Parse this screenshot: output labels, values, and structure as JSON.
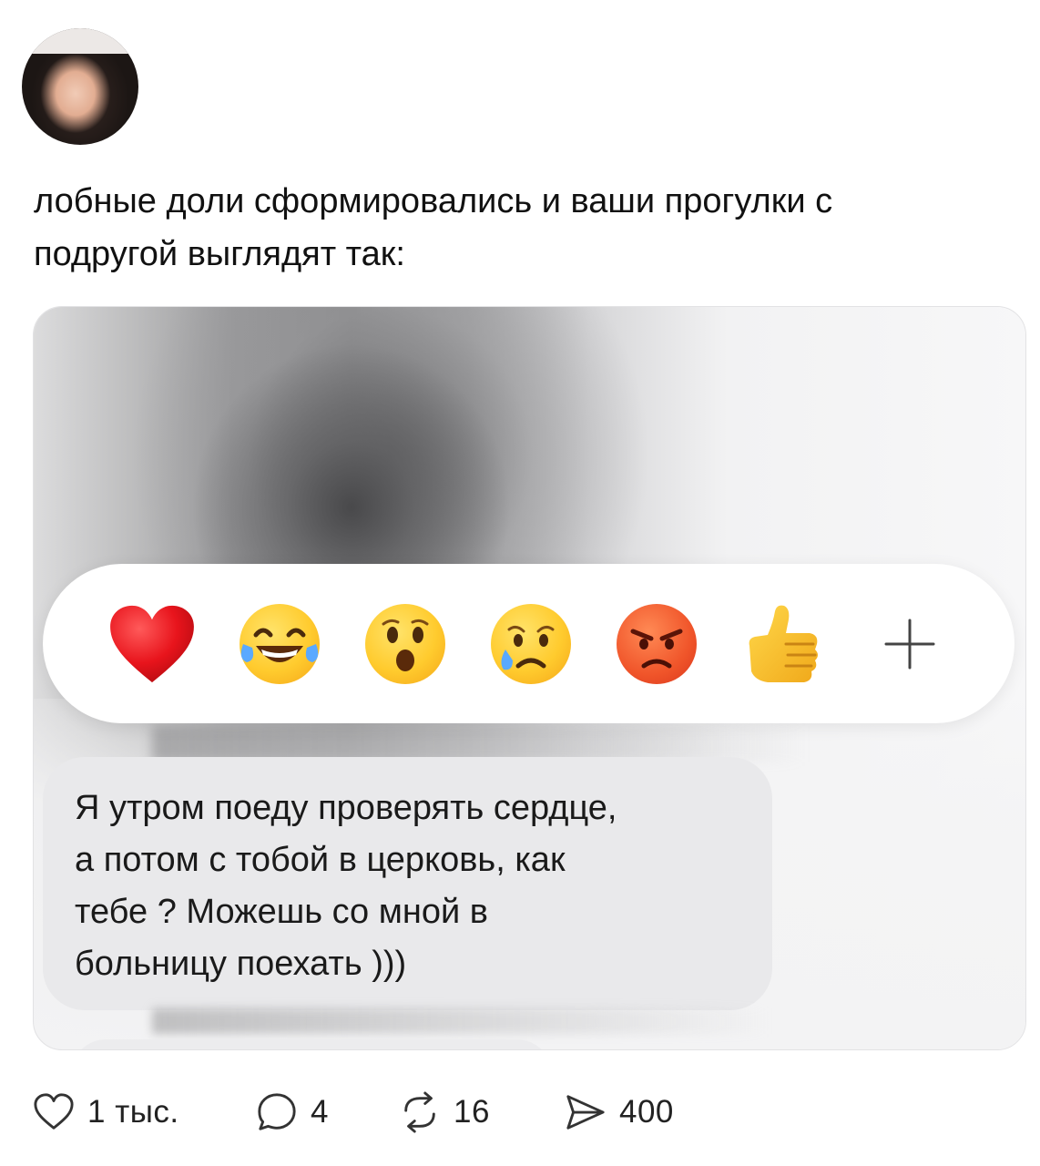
{
  "post": {
    "text_line1": "лобные доли сформировались и ваши прогулки с",
    "text_line2": "подругой выглядят так:"
  },
  "reactions": {
    "items": [
      {
        "name": "red-heart",
        "glyph": "❤️"
      },
      {
        "name": "face-with-tears-of-joy",
        "glyph": "😂"
      },
      {
        "name": "face-with-open-mouth",
        "glyph": "😮"
      },
      {
        "name": "crying-face",
        "glyph": "😢"
      },
      {
        "name": "angry-face",
        "glyph": "😡"
      },
      {
        "name": "thumbs-up",
        "glyph": "👍"
      },
      {
        "name": "plus",
        "glyph": "+"
      }
    ]
  },
  "message": {
    "line1": "Я утром поеду проверять сердце,",
    "line2": "а потом с тобой в церковь, как",
    "line3": "тебе ? Можешь со мной в",
    "line4": "больницу поехать )))"
  },
  "actions": {
    "likes": "1 тыс.",
    "comments": "4",
    "reposts": "16",
    "shares": "400"
  },
  "colors": {
    "bubble": "#e9e9eb",
    "heart": "#e8141c",
    "text": "#111111"
  }
}
